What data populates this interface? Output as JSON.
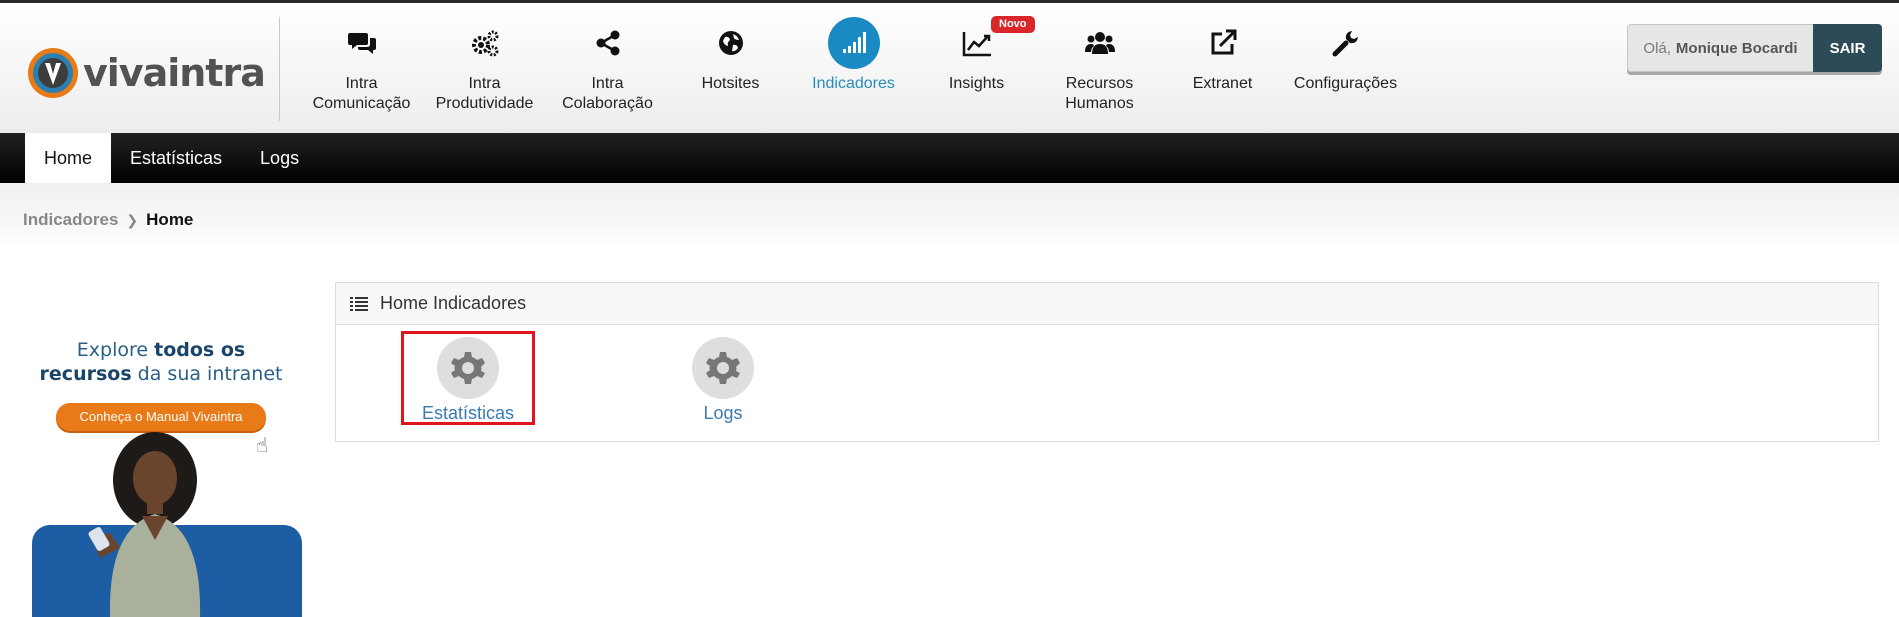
{
  "header": {
    "logo_text": "vivaintra",
    "modules": [
      {
        "label": "Intra\nComunicação",
        "icon": "chat-icon"
      },
      {
        "label": "Intra\nProdutividade",
        "icon": "gears-icon"
      },
      {
        "label": "Intra\nColaboração",
        "icon": "share-icon"
      },
      {
        "label": "Hotsites",
        "icon": "globe-icon"
      },
      {
        "label": "Indicadores",
        "icon": "signal-bars-icon",
        "active": true
      },
      {
        "label": "Insights",
        "icon": "line-chart-icon",
        "badge": "Novo"
      },
      {
        "label": "Recursos\nHumanos",
        "icon": "users-icon"
      },
      {
        "label": "Extranet",
        "icon": "external-link-icon"
      },
      {
        "label": "Configurações",
        "icon": "wrench-icon"
      }
    ],
    "user": {
      "greeting": "Olá,",
      "name": "Monique Bocardi",
      "logout_label": "SAIR"
    }
  },
  "subnav": {
    "tabs": [
      {
        "label": "Home",
        "active": true
      },
      {
        "label": "Estatísticas"
      },
      {
        "label": "Logs"
      }
    ]
  },
  "breadcrumb": {
    "parent": "Indicadores",
    "current": "Home"
  },
  "promo": {
    "line1_pre": "Explore ",
    "line1_bold": "todos os",
    "line2_bold": "recursos",
    "line2_post": " da sua intranet",
    "button_label": "Conheça o Manual Vivaintra"
  },
  "panel": {
    "title": "Home Indicadores",
    "items": [
      {
        "label": "Estatísticas",
        "icon": "gear-icon"
      },
      {
        "label": "Logs",
        "icon": "gear-icon"
      }
    ]
  },
  "colors": {
    "accent": "#1a8bc2",
    "logout_bg": "#2c4b56",
    "badge": "#d9262b",
    "highlight": "#e0161c",
    "promo_button": "#e87a17"
  }
}
